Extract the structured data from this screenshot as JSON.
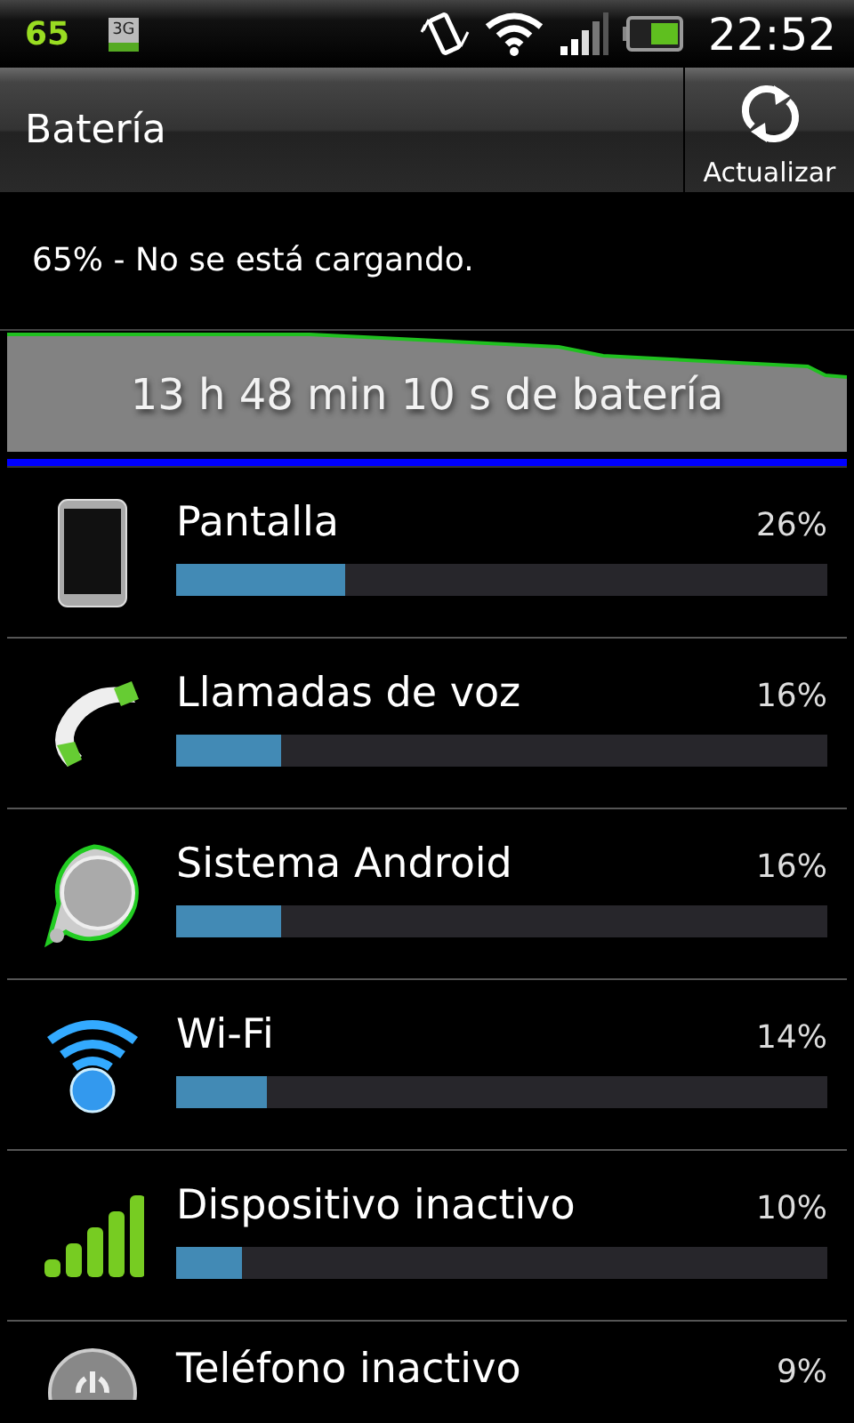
{
  "status_bar": {
    "battery_percent": "65",
    "network_label": "3G",
    "time": "22:52"
  },
  "action_bar": {
    "title": "Batería",
    "action": "Actualizar"
  },
  "summary": "65% - No se está cargando.",
  "graph": {
    "caption": "13 h 48 min 10 s de batería"
  },
  "usage": [
    {
      "kind": "screen",
      "name": "Pantalla",
      "percent": "26%",
      "level": 0.26
    },
    {
      "kind": "call",
      "name": "Llamadas de voz",
      "percent": "16%",
      "level": 0.16
    },
    {
      "kind": "system",
      "name": "Sistema Android",
      "percent": "16%",
      "level": 0.16
    },
    {
      "kind": "wifi",
      "name": "Wi-Fi",
      "percent": "14%",
      "level": 0.14
    },
    {
      "kind": "idle",
      "name": "Dispositivo inactivo",
      "percent": "10%",
      "level": 0.1
    },
    {
      "kind": "power",
      "name": "Teléfono inactivo",
      "percent": "9%"
    }
  ]
}
